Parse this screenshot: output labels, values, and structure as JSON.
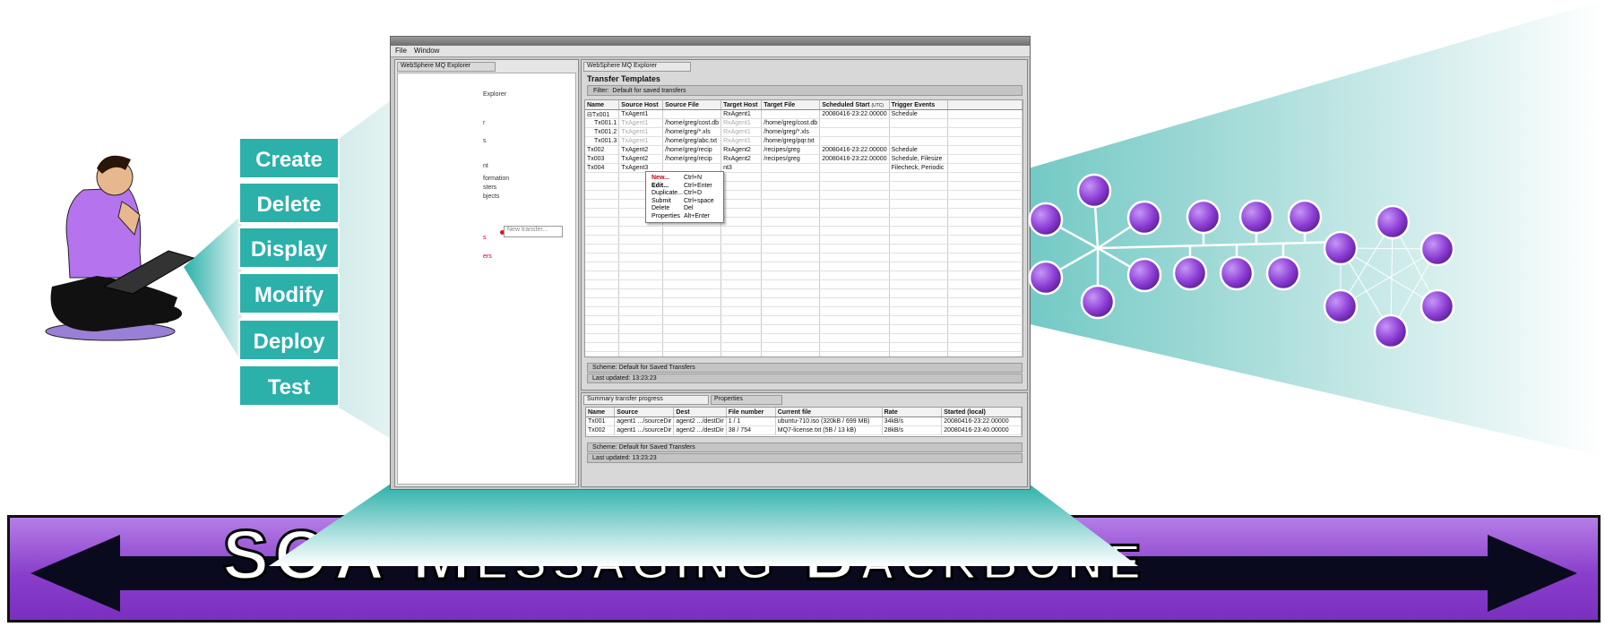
{
  "backbone": {
    "title": "SOA Messaging Backbone"
  },
  "actions": [
    "Create",
    "Delete",
    "Display",
    "Modify",
    "Deploy",
    "Test"
  ],
  "window": {
    "menu": [
      "File",
      "Window"
    ],
    "left_tab": "WebSphere MQ Explorer",
    "left_tree_visible": [
      "Explorer",
      "r",
      "s",
      "nt",
      "formation",
      "sters",
      "bjects",
      "s",
      "ers"
    ],
    "new_transfer_placeholder": "New transfer...",
    "right_tab": "WebSphere MQ Explorer",
    "templates_title": "Transfer Templates",
    "filter_label": "Filter:",
    "filter_value": "Default for saved transfers",
    "columns": [
      "Name",
      "Source Host",
      "Source File",
      "Target Host",
      "Target File",
      "Scheduled Start",
      "Trigger Events"
    ],
    "scheduled_suffix": "(UTC)",
    "rows": [
      {
        "name": "⊟Tx001",
        "src_host": "TxAgent1",
        "src_file": "",
        "tgt_host": "RxAgent1",
        "tgt_file": "",
        "start": "20080416-23:22.00000",
        "trigger": "Schedule",
        "dim": false
      },
      {
        "name": "Tx001.1",
        "src_host": "TxAgent1",
        "src_file": "/home/greg/cost.db",
        "tgt_host": "RxAgent1",
        "tgt_file": "/home/greg/cost.db",
        "start": "",
        "trigger": "",
        "dim": true
      },
      {
        "name": "Tx001.2",
        "src_host": "TxAgent1",
        "src_file": "/home/greg/*.xls",
        "tgt_host": "RxAgent1",
        "tgt_file": "/home/greg/*.xls",
        "start": "",
        "trigger": "",
        "dim": true
      },
      {
        "name": "Tx001.3",
        "src_host": "TxAgent1",
        "src_file": "/home/greg/abc.txt",
        "tgt_host": "RxAgent1",
        "tgt_file": "/home/greg/pqr.txt",
        "start": "",
        "trigger": "",
        "dim": true
      },
      {
        "name": "Tx002",
        "src_host": "TxAgent2",
        "src_file": "/home/greg/recip",
        "tgt_host": "RxAgent2",
        "tgt_file": "/recipes/greg",
        "start": "20080416-23:22.00000",
        "trigger": "Schedule",
        "dim": false
      },
      {
        "name": "Tx003",
        "src_host": "TxAgent2",
        "src_file": "/home/greg/recip",
        "tgt_host": "RxAgent2",
        "tgt_file": "/recipes/greg",
        "start": "20080416-23:22.00000",
        "trigger": "Schedule, Filesize",
        "dim": false
      },
      {
        "name": "Tx004",
        "src_host": "TxAgent3",
        "src_file": "",
        "tgt_host": "nt3",
        "tgt_file": "",
        "start": "",
        "trigger": "Filecheck, Periodic",
        "dim": false
      }
    ],
    "context_menu": [
      {
        "label": "New...",
        "key": "Ctrl+N"
      },
      {
        "label": "Edit...",
        "key": "Ctrl+Enter"
      },
      {
        "label": "Duplicate...",
        "key": "Ctrl+D"
      },
      {
        "label": "Submit",
        "key": "Ctrl+space"
      },
      {
        "label": "Delete",
        "key": "Del"
      },
      {
        "label": "Properties",
        "key": "Alt+Enter"
      }
    ],
    "scheme": "Scheme: Default for Saved Transfers",
    "last_updated": "Last updated:  13:23:23",
    "bottom_tabs": [
      "Summary transfer progress",
      "Properties"
    ],
    "progress_columns": [
      "Name",
      "Source",
      "Dest",
      "File number",
      "Current file",
      "Rate",
      "Started (local)"
    ],
    "progress_rows": [
      {
        "name": "Tx001",
        "source": "agent1 .../sourceDir",
        "dest": "agent2 .../destDir",
        "file_number": "1 / 1",
        "current": "ubuntu-710.iso (320kB / 699 MB)",
        "rate": "34kB/s",
        "started": "20080416-23:22.00000"
      },
      {
        "name": "Tx002",
        "source": "agent1 .../sourceDir",
        "dest": "agent2 .../destDir",
        "file_number": "38 / 754",
        "current": "MQ7-license.txt (5B / 13 kB)",
        "rate": "28kB/s",
        "started": "20080416-23:40.00000"
      }
    ]
  },
  "colors": {
    "teal": "#2bb0aa",
    "purple": "#8a3fcc",
    "node_purple": "#8e3fd6"
  }
}
